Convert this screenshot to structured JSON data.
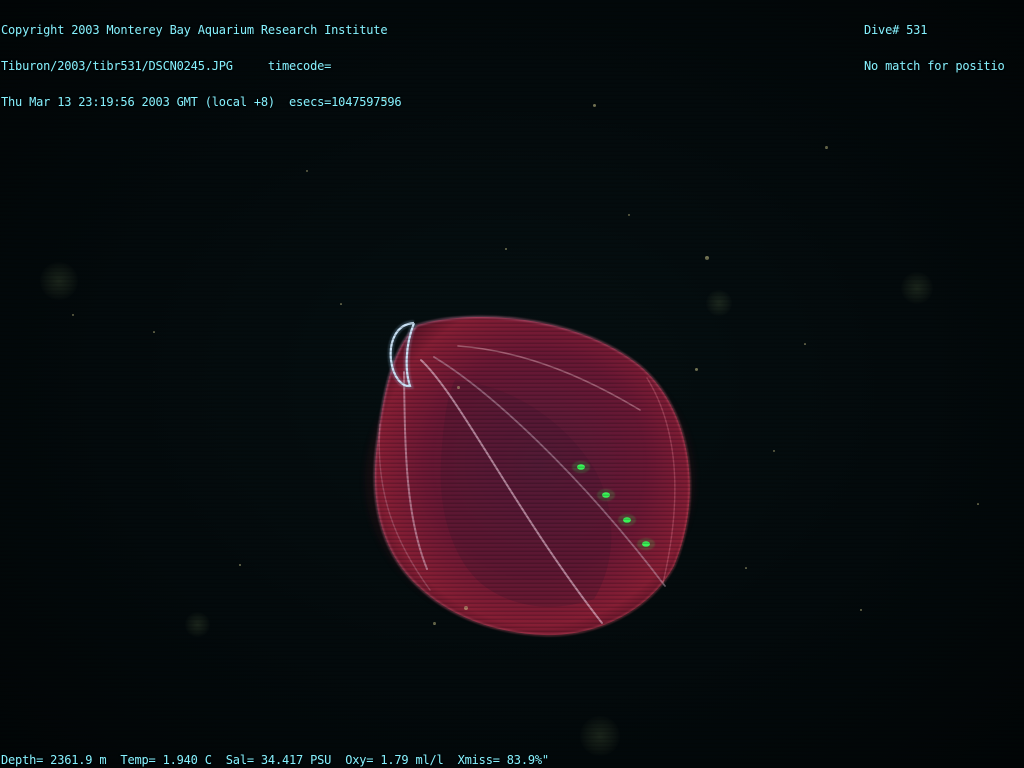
{
  "overlay": {
    "copyright": "Copyright 2003 Monterey Bay Aquarium Research Institute",
    "file_path": "Tiburon/2003/tibr531/DSCN0245.JPG     timecode=",
    "datetime": "Thu Mar 13 23:19:56 2003 GMT (local +8)  esecs=1047597596",
    "dive": "Dive# 531",
    "position_status": "No match for positio",
    "sensors": "Depth= 2361.9 m  Temp= 1.940 C  Sal= 34.417 PSU  Oxy= 1.79 ml/l  Xmiss= 83.9%\""
  },
  "colors": {
    "overlay_text": "#86f2ff",
    "background": "#020709",
    "body": "#7a1a3c",
    "comb_rows": "#39ff5a"
  }
}
